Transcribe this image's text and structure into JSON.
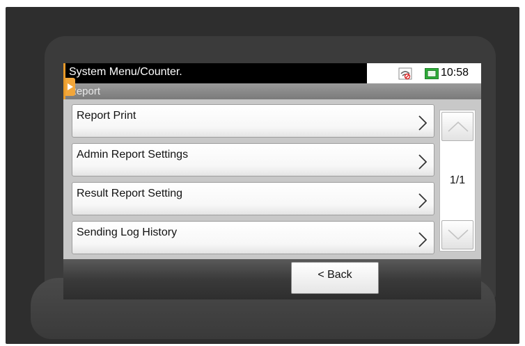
{
  "status_bar": {
    "title": "System Menu/Counter.",
    "time": "10:58",
    "network_icon": "network-disconnected-icon",
    "status_icon": "device-status-icon"
  },
  "sub_header": {
    "title": "Report"
  },
  "menu_items": [
    {
      "label": "Report Print"
    },
    {
      "label": "Admin Report Settings"
    },
    {
      "label": "Result Report Setting"
    },
    {
      "label": "Sending Log History"
    }
  ],
  "pager": {
    "count": "1/1"
  },
  "footer": {
    "back_label": "< Back"
  },
  "colors": {
    "accent_orange": "#f2a63a",
    "status_green": "#2fae3a",
    "screen_bg": "#c8c8c8"
  }
}
